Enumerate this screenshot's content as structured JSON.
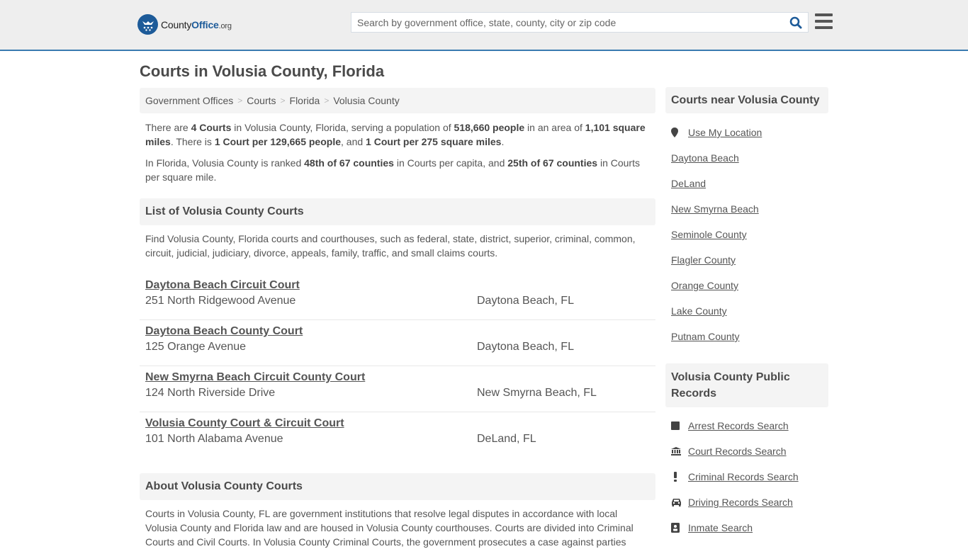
{
  "header": {
    "logo": {
      "county": "County",
      "office": "Office",
      "org": ".org"
    },
    "search_placeholder": "Search by government office, state, county, city or zip code",
    "colors": {
      "brand": "#1d5b99",
      "accent_border": "#3a7bb0"
    }
  },
  "page_title": "Courts in Volusia County, Florida",
  "breadcrumb": [
    "Government Offices",
    "Courts",
    "Florida",
    "Volusia County"
  ],
  "summary": {
    "p1": {
      "t1": "There are ",
      "b1": "4 Courts",
      "t2": " in Volusia County, Florida, serving a population of ",
      "b2": "518,660 people",
      "t3": " in an area of ",
      "b3": "1,101 square miles",
      "t4": ". There is ",
      "b4": "1 Court per 129,665 people",
      "t5": ", and ",
      "b5": "1 Court per 275 square miles",
      "t6": "."
    },
    "p2": {
      "t1": "In Florida, Volusia County is ranked ",
      "b1": "48th of 67 counties",
      "t2": " in Courts per capita, and ",
      "b2": "25th of 67 counties",
      "t3": " in Courts per square mile."
    }
  },
  "list_section": {
    "heading": "List of Volusia County Courts",
    "description": "Find Volusia County, Florida courts and courthouses, such as federal, state, district, superior, criminal, common, circuit, judicial, judiciary, divorce, appeals, family, traffic, and small claims courts.",
    "courts": [
      {
        "name": "Daytona Beach Circuit Court",
        "address": "251 North Ridgewood Avenue",
        "city": "Daytona Beach, FL"
      },
      {
        "name": "Daytona Beach County Court",
        "address": "125 Orange Avenue",
        "city": "Daytona Beach, FL"
      },
      {
        "name": "New Smyrna Beach Circuit County Court",
        "address": "124 North Riverside Drive",
        "city": "New Smyrna Beach, FL"
      },
      {
        "name": "Volusia County Court & Circuit Court",
        "address": "101 North Alabama Avenue",
        "city": "DeLand, FL"
      }
    ]
  },
  "about_section": {
    "heading": "About Volusia County Courts",
    "text": "Courts in Volusia County, FL are government institutions that resolve legal disputes in accordance with local Volusia County and Florida law and are housed in Volusia County courthouses. Courts are divided into Criminal Courts and Civil Courts. In Volusia County Criminal Courts, the government prosecutes a case against parties"
  },
  "sidebar": {
    "nearby_heading": "Courts near Volusia County",
    "use_location": "Use My Location",
    "nearby": [
      "Daytona Beach",
      "DeLand",
      "New Smyrna Beach",
      "Seminole County",
      "Flagler County",
      "Orange County",
      "Lake County",
      "Putnam County"
    ],
    "records_heading": "Volusia County Public Records",
    "records": [
      {
        "label": "Arrest Records Search",
        "icon": "square-icon"
      },
      {
        "label": "Court Records Search",
        "icon": "courthouse-icon"
      },
      {
        "label": "Criminal Records Search",
        "icon": "exclamation-icon"
      },
      {
        "label": "Driving Records Search",
        "icon": "car-icon"
      },
      {
        "label": "Inmate Search",
        "icon": "id-badge-icon"
      }
    ]
  }
}
